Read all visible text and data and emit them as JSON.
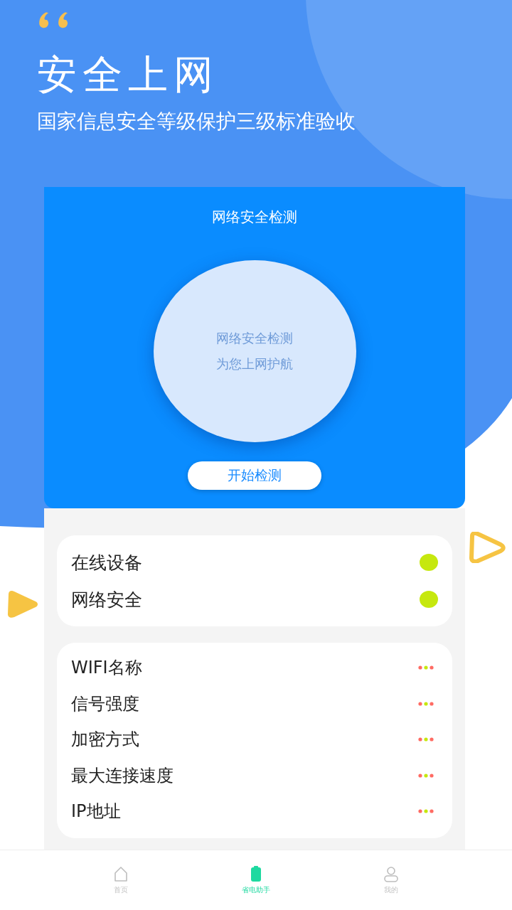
{
  "header": {
    "title": "安全上网",
    "subtitle": "国家信息安全等级保护三级标准验收"
  },
  "scan_card": {
    "title": "网络安全检测",
    "circle_lines": [
      "网络安全检测",
      "为您上网护航"
    ],
    "button": "开始检测"
  },
  "status_items": [
    {
      "label": "在线设备"
    },
    {
      "label": "网络安全"
    }
  ],
  "info_items": [
    {
      "label": "WIFI名称"
    },
    {
      "label": "信号强度"
    },
    {
      "label": "加密方式"
    },
    {
      "label": "最大连接速度"
    },
    {
      "label": "IP地址"
    }
  ],
  "tab_bar": [
    {
      "label": "首页",
      "kind": "home",
      "selected": false
    },
    {
      "label": "省电助手",
      "kind": "battery",
      "selected": true
    },
    {
      "label": "我的",
      "kind": "person",
      "selected": false
    }
  ]
}
